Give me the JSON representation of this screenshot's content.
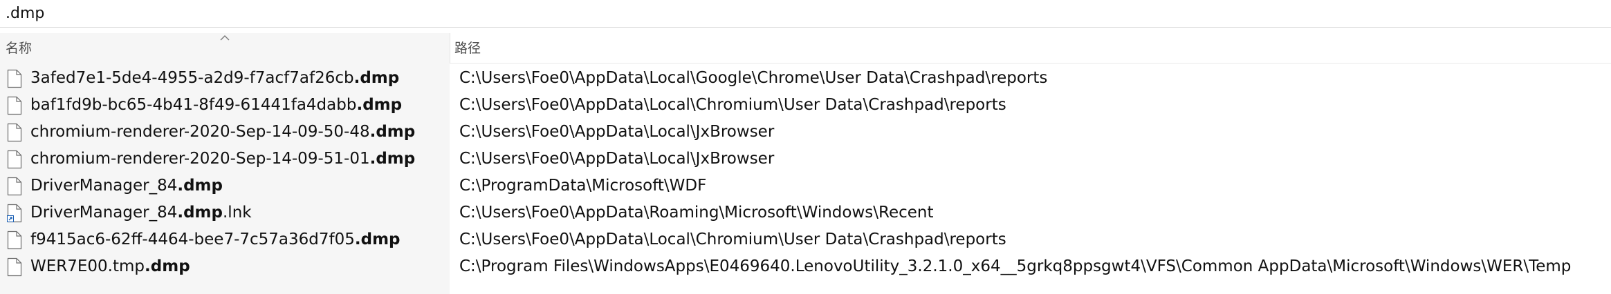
{
  "search": {
    "value": ".dmp"
  },
  "columns": {
    "name": "名称",
    "path": "路径"
  },
  "icons": {
    "file": "document-file-icon",
    "shortcut": "shortcut-file-icon",
    "sort": "sort-ascending-arrow-icon"
  },
  "rows": [
    {
      "base": "3afed7e1-5de4-4955-a2d9-f7acf7af26cb",
      "ext": ".dmp",
      "suffix": "",
      "path": "C:\\Users\\Foe0\\AppData\\Local\\Google\\Chrome\\User Data\\Crashpad\\reports",
      "icon": "file"
    },
    {
      "base": "baf1fd9b-bc65-4b41-8f49-61441fa4dabb",
      "ext": ".dmp",
      "suffix": "",
      "path": "C:\\Users\\Foe0\\AppData\\Local\\Chromium\\User Data\\Crashpad\\reports",
      "icon": "file"
    },
    {
      "base": "chromium-renderer-2020-Sep-14-09-50-48",
      "ext": ".dmp",
      "suffix": "",
      "path": "C:\\Users\\Foe0\\AppData\\Local\\JxBrowser",
      "icon": "file"
    },
    {
      "base": "chromium-renderer-2020-Sep-14-09-51-01",
      "ext": ".dmp",
      "suffix": "",
      "path": "C:\\Users\\Foe0\\AppData\\Local\\JxBrowser",
      "icon": "file"
    },
    {
      "base": "DriverManager_84",
      "ext": ".dmp",
      "suffix": "",
      "path": "C:\\ProgramData\\Microsoft\\WDF",
      "icon": "file"
    },
    {
      "base": "DriverManager_84",
      "ext": ".dmp",
      "suffix": ".lnk",
      "path": "C:\\Users\\Foe0\\AppData\\Roaming\\Microsoft\\Windows\\Recent",
      "icon": "shortcut"
    },
    {
      "base": "f9415ac6-62ff-4464-bee7-7c57a36d7f05",
      "ext": ".dmp",
      "suffix": "",
      "path": "C:\\Users\\Foe0\\AppData\\Local\\Chromium\\User Data\\Crashpad\\reports",
      "icon": "file"
    },
    {
      "base": "WER7E00.tmp",
      "ext": ".dmp",
      "suffix": "",
      "path": "C:\\Program Files\\WindowsApps\\E0469640.LenovoUtility_3.2.1.0_x64__5grkq8ppsgwt4\\VFS\\Common AppData\\Microsoft\\Windows\\WER\\Temp",
      "icon": "file"
    }
  ]
}
